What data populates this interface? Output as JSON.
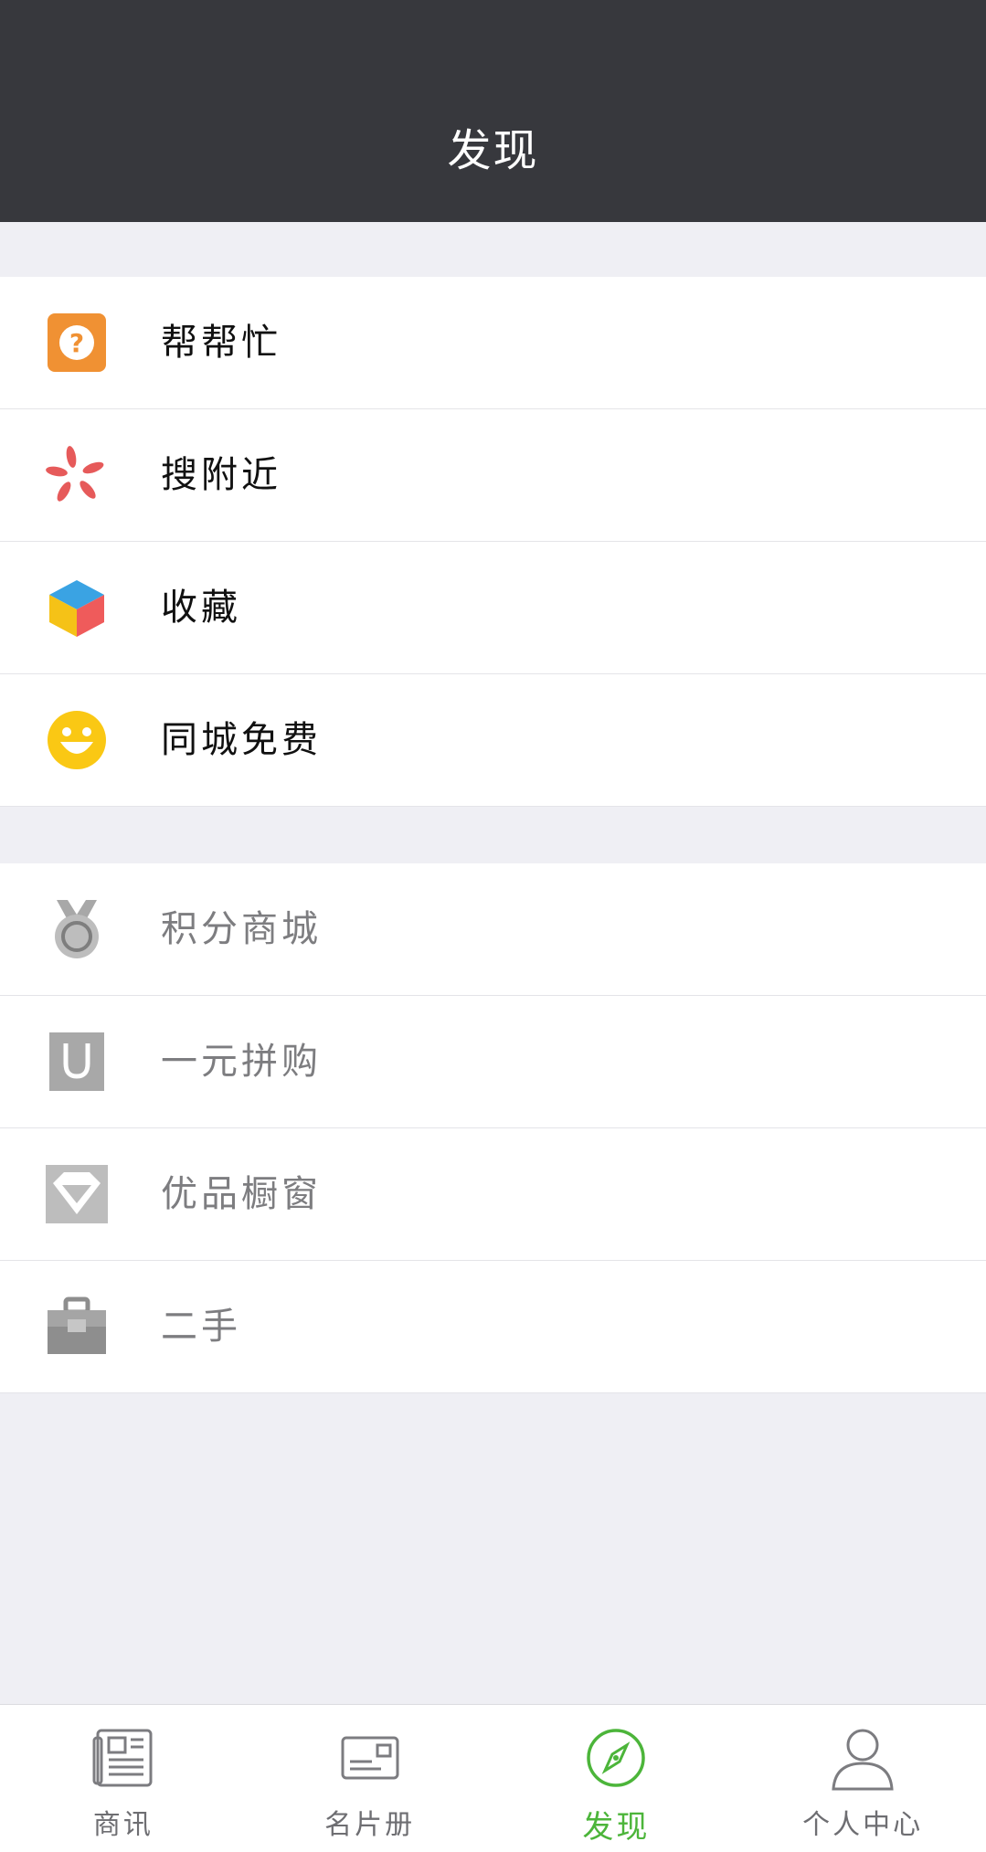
{
  "header": {
    "title": "发现"
  },
  "colors": {
    "header_bg": "#37383d",
    "page_bg": "#efeff4",
    "accent": "#4cb53a",
    "inactive_text": "#7d7d80"
  },
  "section1": {
    "items": [
      {
        "label": "帮帮忙",
        "icon": "question-icon"
      },
      {
        "label": "搜附近",
        "icon": "pinwheel-icon"
      },
      {
        "label": "收藏",
        "icon": "cube-icon"
      },
      {
        "label": "同城免费",
        "icon": "smiley-icon"
      }
    ]
  },
  "section2": {
    "items": [
      {
        "label": "积分商城",
        "icon": "medal-icon"
      },
      {
        "label": "一元拼购",
        "icon": "shopping-bag-icon"
      },
      {
        "label": "优品橱窗",
        "icon": "diamond-icon"
      },
      {
        "label": "二手",
        "icon": "briefcase-icon"
      }
    ]
  },
  "tabbar": {
    "tabs": [
      {
        "label": "商讯",
        "icon": "newspaper-icon"
      },
      {
        "label": "名片册",
        "icon": "card-icon"
      },
      {
        "label": "发现",
        "icon": "compass-icon",
        "active": true
      },
      {
        "label": "个人中心",
        "icon": "person-icon"
      }
    ]
  }
}
